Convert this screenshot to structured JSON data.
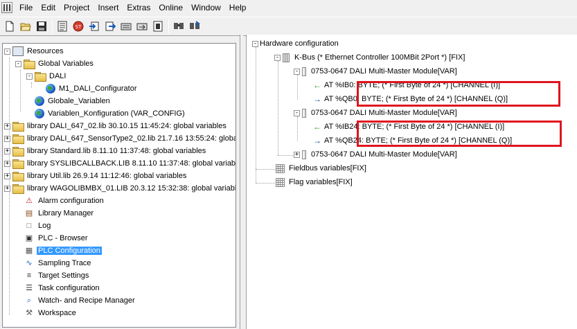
{
  "menu": [
    "File",
    "Edit",
    "Project",
    "Insert",
    "Extras",
    "Online",
    "Window",
    "Help"
  ],
  "toolbar": {
    "buttons": [
      "new-icon",
      "open-icon",
      "save-icon",
      "compile-icon",
      "stop-icon",
      "login-icon",
      "logout-icon",
      "run-icon",
      "step-icon",
      "breakpoint-icon",
      "search-icon",
      "replace-icon"
    ]
  },
  "left_tree": {
    "items": [
      {
        "label": "Resources",
        "icon": "resources-icon",
        "expander": "-"
      },
      {
        "label": "Global Variables",
        "icon": "folder-icon",
        "expander": "-"
      },
      {
        "label": "DALI",
        "icon": "folder-icon",
        "expander": "-"
      },
      {
        "label": "M1_DALI_Configurator",
        "icon": "globe-icon",
        "expander": ""
      },
      {
        "label": "Globale_Variablen",
        "icon": "globe-icon",
        "expander": ""
      },
      {
        "label": "Variablen_Konfiguration (VAR_CONFIG)",
        "icon": "globe-icon",
        "expander": ""
      },
      {
        "label": "library DALI_647_02.lib 30.10.15 11:45:24: global variables",
        "icon": "folder-icon",
        "expander": "+"
      },
      {
        "label": "library DALI_647_SensorType2_02.lib 21.7.16 13:55:24: globa",
        "icon": "folder-icon",
        "expander": "+"
      },
      {
        "label": "library Standard.lib 8.11.10 11:37:48: global variables",
        "icon": "folder-icon",
        "expander": "+"
      },
      {
        "label": "library SYSLIBCALLBACK.LIB 8.11.10 11:37:48: global variabl",
        "icon": "folder-icon",
        "expander": "+"
      },
      {
        "label": "library Util.lib 26.9.14 11:12:46: global variables",
        "icon": "folder-icon",
        "expander": "+"
      },
      {
        "label": "library WAGOLIBMBX_01.LIB 20.3.12 15:32:38: global variabl",
        "icon": "folder-icon",
        "expander": "+"
      },
      {
        "label": "Alarm configuration",
        "icon": "alarm-icon",
        "expander": ""
      },
      {
        "label": "Library Manager",
        "icon": "library-icon",
        "expander": ""
      },
      {
        "label": "Log",
        "icon": "log-icon",
        "expander": ""
      },
      {
        "label": "PLC - Browser",
        "icon": "browser-icon",
        "expander": ""
      },
      {
        "label": "PLC Configuration",
        "icon": "plc-config-icon",
        "expander": "",
        "selected": true
      },
      {
        "label": "Sampling Trace",
        "icon": "trace-icon",
        "expander": ""
      },
      {
        "label": "Target Settings",
        "icon": "target-icon",
        "expander": ""
      },
      {
        "label": "Task configuration",
        "icon": "task-icon",
        "expander": ""
      },
      {
        "label": "Watch- and Recipe Manager",
        "icon": "watch-icon",
        "expander": ""
      },
      {
        "label": "Workspace",
        "icon": "workspace-icon",
        "expander": ""
      }
    ]
  },
  "right_tree": {
    "root": "Hardware configuration",
    "kbus": "K-Bus (* Ethernet Controller 100MBit 2Port *) [FIX]",
    "module1": "0753-0647 DALI Multi-Master Module[VAR]",
    "m1_in": "AT %IB0: BYTE; (* First Byte of 24 *) [CHANNEL (I)]",
    "m1_out": "AT %QB0: BYTE; (* First Byte of 24 *) [CHANNEL (Q)]",
    "module2": "0753-0647 DALI Multi-Master Module[VAR]",
    "m2_in": "AT %IB24: BYTE; (* First Byte of 24 *) [CHANNEL (I)]",
    "m2_out": "AT %QB24: BYTE; (* First Byte of 24 *) [CHANNEL (Q)]",
    "module3": "0753-0647 DALI Multi-Master Module[VAR]",
    "fieldbus": "Fieldbus variables[FIX]",
    "flag": "Flag variables[FIX]"
  },
  "colors": {
    "selection": "#3399ff",
    "highlight_box": "#e0141e",
    "input_arrow": "#1a9b1a",
    "output_arrow": "#123f9c"
  }
}
